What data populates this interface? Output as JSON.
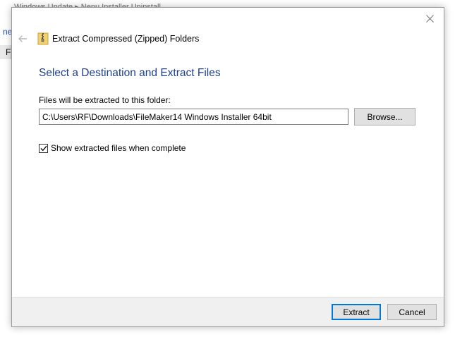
{
  "background": {
    "title_fragment": "Windows Update ▸ Nenu Installer Uninstall..",
    "left_fragment_1": "ne",
    "left_fragment_2": "Fi"
  },
  "dialog": {
    "window_title": "Extract Compressed (Zipped) Folders",
    "heading": "Select a Destination and Extract Files",
    "destination_label": "Files will be extracted to this folder:",
    "destination_value": "C:\\Users\\RF\\Downloads\\FileMaker14 Windows Installer 64bit",
    "browse_label": "Browse...",
    "show_files_label": "Show extracted files when complete",
    "show_files_checked": true,
    "extract_label": "Extract",
    "cancel_label": "Cancel",
    "icons": {
      "back": "back-arrow-icon",
      "zip": "zip-folder-icon",
      "close": "close-icon",
      "check": "checkmark-icon"
    },
    "colors": {
      "heading": "#1e3f8e",
      "default_button_border": "#0078d7",
      "footer_bg": "#f0f0f0"
    }
  }
}
